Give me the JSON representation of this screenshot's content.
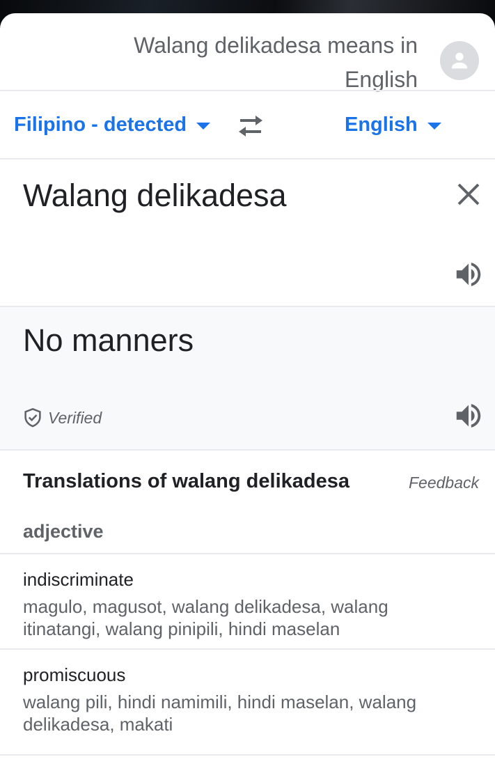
{
  "header": {
    "query_title": "Walang delikadesa means in English",
    "avatar_icon": "account-avatar-icon"
  },
  "languages": {
    "source": "Filipino - detected",
    "target": "English",
    "swap_icon": "swap-arrows-icon",
    "accent_color": "#1a73e8"
  },
  "input": {
    "text": "Walang delikadesa",
    "clear_icon": "close-icon",
    "speaker_icon": "speaker-icon"
  },
  "output": {
    "text": "No manners",
    "verified_label": "Verified",
    "verified_icon": "shield-check-icon",
    "speaker_icon": "speaker-icon"
  },
  "translations": {
    "title": "Translations of walang delikadesa",
    "feedback_label": "Feedback",
    "part_of_speech": "adjective",
    "entries": [
      {
        "word": "indiscriminate",
        "synonyms": "magulo, magusot, walang delikadesa, walang itinatangi, walang pinipili, hindi maselan"
      },
      {
        "word": "promiscuous",
        "synonyms": "walang pili, hindi namimili, hindi maselan, walang delikadesa, makati"
      }
    ]
  }
}
